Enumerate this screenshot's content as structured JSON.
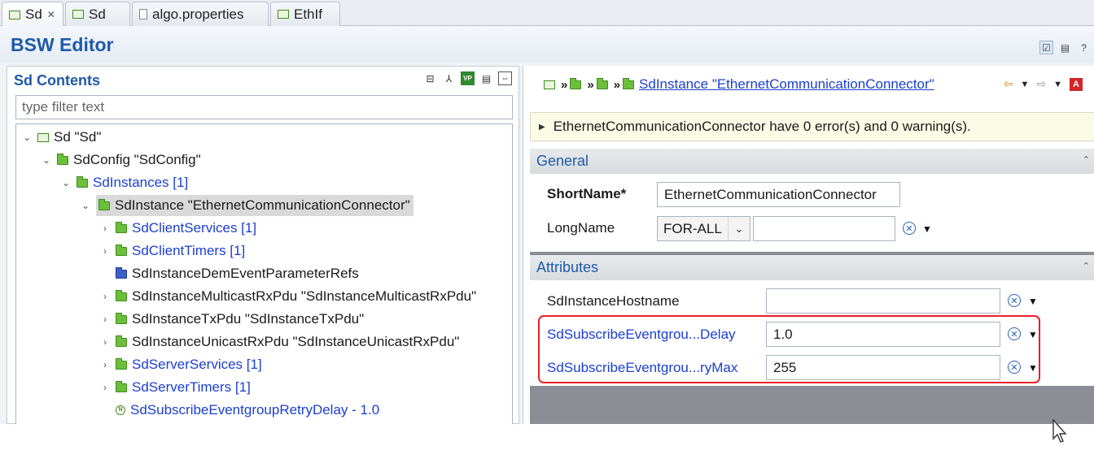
{
  "tabs": [
    {
      "label": "Sd",
      "icon": "module-icon",
      "active": true,
      "closable": true
    },
    {
      "label": "Sd",
      "icon": "module-icon",
      "active": false
    },
    {
      "label": "algo.properties",
      "icon": "file-icon",
      "active": false
    },
    {
      "label": "EthIf",
      "icon": "module-icon",
      "active": false
    }
  ],
  "editor": {
    "title": "BSW Editor"
  },
  "left_panel": {
    "title": "Sd Contents",
    "filter_placeholder": "type filter text",
    "tree": [
      {
        "label": "Sd \"Sd\"",
        "icon": "module",
        "link": false,
        "expanded": true
      },
      {
        "label": "SdConfig \"SdConfig\"",
        "icon": "folder",
        "link": false,
        "expanded": true
      },
      {
        "label": "SdInstances [1]",
        "icon": "folder",
        "link": true,
        "expanded": true
      },
      {
        "label": "SdInstance \"EthernetCommunicationConnector\"",
        "icon": "folder",
        "link": false,
        "expanded": true,
        "selected": true
      },
      {
        "label": "SdClientServices [1]",
        "icon": "folder",
        "link": true,
        "expanded": false
      },
      {
        "label": "SdClientTimers [1]",
        "icon": "folder",
        "link": true,
        "expanded": false
      },
      {
        "label": "SdInstanceDemEventParameterRefs",
        "icon": "folder-blue",
        "link": false,
        "expanded": null
      },
      {
        "label": "SdInstanceMulticastRxPdu \"SdInstanceMulticastRxPdu\"",
        "icon": "folder",
        "link": false,
        "expanded": false
      },
      {
        "label": "SdInstanceTxPdu \"SdInstanceTxPdu\"",
        "icon": "folder",
        "link": false,
        "expanded": false
      },
      {
        "label": "SdInstanceUnicastRxPdu \"SdInstanceUnicastRxPdu\"",
        "icon": "folder",
        "link": false,
        "expanded": false
      },
      {
        "label": "SdServerServices [1]",
        "icon": "folder",
        "link": true,
        "expanded": false
      },
      {
        "label": "SdServerTimers [1]",
        "icon": "folder",
        "link": true,
        "expanded": false
      },
      {
        "label": "SdSubscribeEventgroupRetryDelay - 1.0",
        "icon": "param",
        "link": true,
        "expanded": null
      }
    ]
  },
  "right_panel": {
    "breadcrumb_current": "SdInstance \"EthernetCommunicationConnector\"",
    "message": "EthernetCommunicationConnector have 0 error(s) and 0 warning(s).",
    "general": {
      "title": "General",
      "shortname_label": "ShortName*",
      "shortname_value": "EthernetCommunicationConnector",
      "longname_label": "LongName",
      "language": "FOR-ALL",
      "longname_value": ""
    },
    "attributes": {
      "title": "Attributes",
      "hostname_label": "SdInstanceHostname",
      "hostname_value": "",
      "retry_delay_label": "SdSubscribeEventgrou...Delay",
      "retry_delay_value": "1.0",
      "retry_max_label": "SdSubscribeEventgrou...ryMax",
      "retry_max_value": "255"
    }
  },
  "colors": {
    "accent": "#1e5aa8",
    "link": "#1a3fcf",
    "highlight": "#e8202a",
    "folder": "#6cbf3a"
  }
}
